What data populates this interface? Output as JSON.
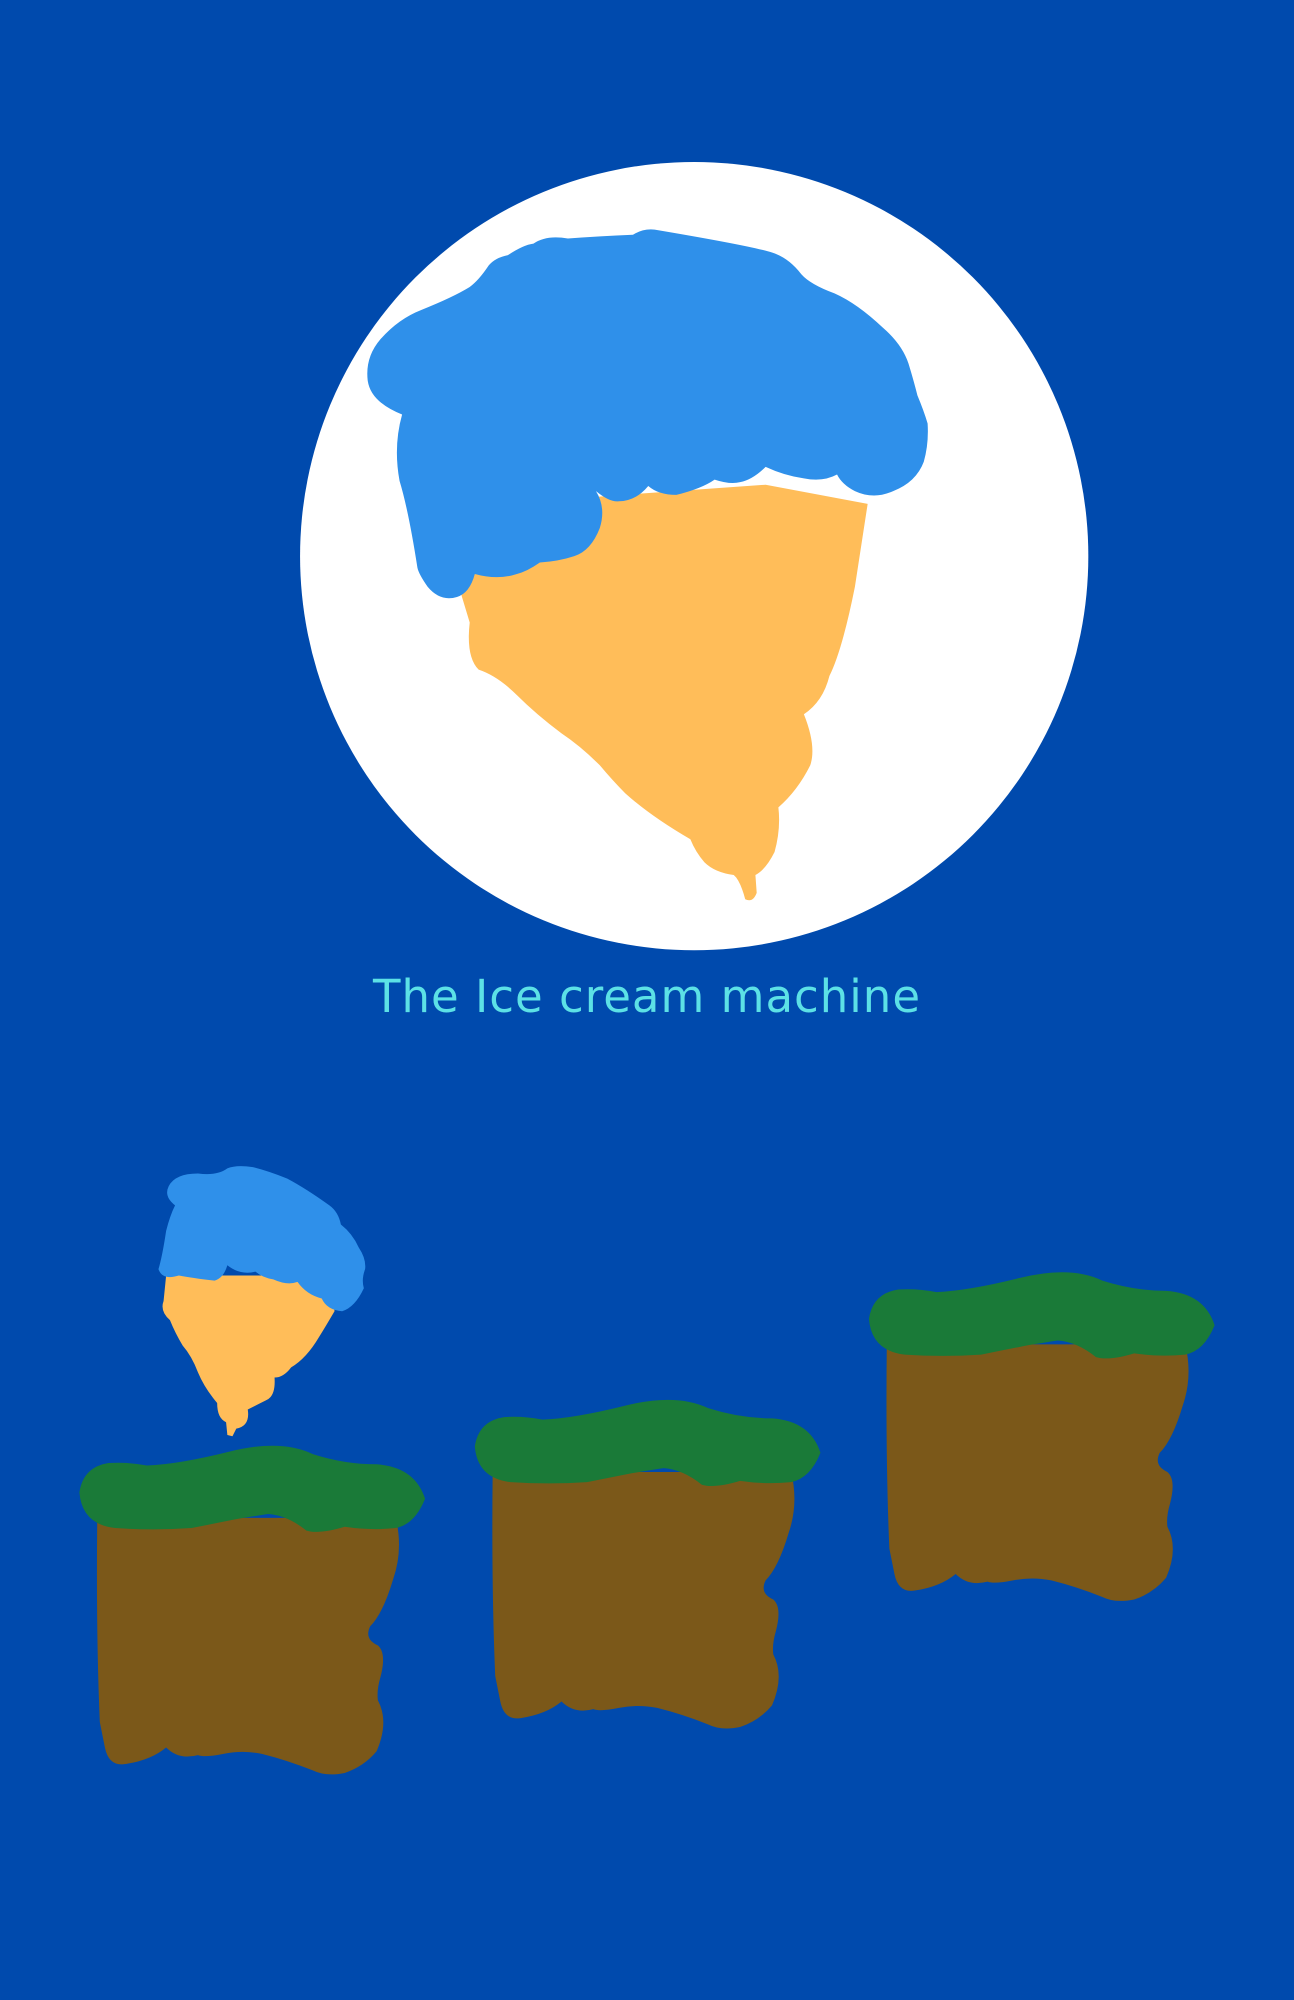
{
  "title": "The Ice cream machine",
  "colors": {
    "background": "#004aad",
    "title": "#5ce1e6",
    "circle": "#ffffff",
    "ice_cream_scoop": "#2f90ea",
    "cone": "#ffbd59",
    "grass": "#1a7a38",
    "dirt": "#7b5819"
  }
}
